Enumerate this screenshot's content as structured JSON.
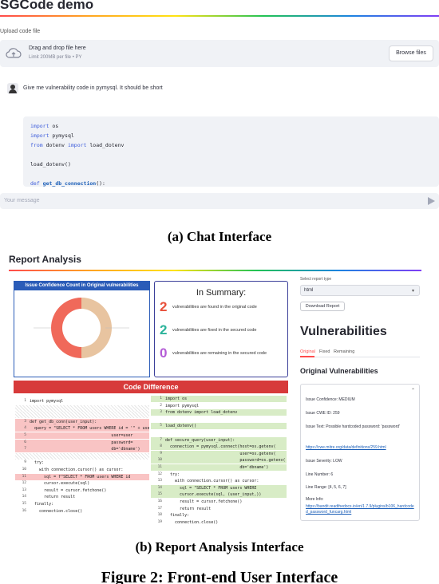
{
  "chat": {
    "app_title": "SGCode demo",
    "upload_label": "Upload code file",
    "dropzone": {
      "main_text": "Drag and drop file here",
      "limit_text": "Limit 200MB per file • PY",
      "browse_label": "Browse files",
      "icon": "cloud-upload-icon"
    },
    "user_message": "Give me vulnerability code in pymysql. It should be short",
    "code_lines": [
      [
        {
          "t": "import",
          "k": "kw"
        },
        {
          "t": " os",
          "k": ""
        }
      ],
      [
        {
          "t": "import",
          "k": "kw"
        },
        {
          "t": " pymysql",
          "k": ""
        }
      ],
      [
        {
          "t": "from",
          "k": "kw"
        },
        {
          "t": " dotenv ",
          "k": ""
        },
        {
          "t": "import",
          "k": "kw"
        },
        {
          "t": " load_dotenv",
          "k": ""
        }
      ],
      [],
      [
        {
          "t": "load_dotenv()",
          "k": ""
        }
      ],
      [],
      [
        {
          "t": "def",
          "k": "kw"
        },
        {
          "t": " get_db_connection",
          "k": "fn"
        },
        {
          "t": "():",
          "k": ""
        }
      ]
    ],
    "input_placeholder": "Your message",
    "send_icon": "send-icon"
  },
  "caption_a": "(a) Chat Interface",
  "report": {
    "title": "Report Analysis",
    "chart_card": {
      "title": "Issue Confidence Count in Original vulnerabilities"
    },
    "chart_data": {
      "type": "pie",
      "donut": true,
      "title": "Issue Confidence Count in Original vulnerabilities",
      "slices": [
        {
          "value": 1,
          "color": "#e8c4a0"
        },
        {
          "value": 1,
          "color": "#f0695a"
        }
      ]
    },
    "summary": {
      "title": "In Summary:",
      "stats": [
        {
          "value": "2",
          "text": "vulnerabilities are found in the original code",
          "color": "#e8503a"
        },
        {
          "value": "2",
          "text": "vulnerabilities are fixed in the secured code",
          "color": "#2bb39a"
        },
        {
          "value": "0",
          "text": "vulnerabilities are remaining in the secured code",
          "color": "#b45cd6"
        }
      ]
    },
    "diff": {
      "title": "Code Difference",
      "left": [
        {
          "n": "1",
          "t": "import pymysql",
          "s": ""
        },
        {
          "n": "",
          "t": "",
          "s": "hatch"
        },
        {
          "n": "",
          "t": "",
          "s": "hatch"
        },
        {
          "n": "3",
          "t": "def get_db_conn(user_input):",
          "s": "del"
        },
        {
          "n": "4",
          "t": "  query = \"SELECT * FROM users WHERE id = '\" + user_input",
          "s": "del"
        },
        {
          "n": "5",
          "t": "                                  user=user",
          "s": "del"
        },
        {
          "n": "6",
          "t": "                                  password=",
          "s": "del"
        },
        {
          "n": "7",
          "t": "                                  db='dbname')",
          "s": "del"
        },
        {
          "n": "",
          "t": "",
          "s": "hatch"
        },
        {
          "n": "9",
          "t": "  try:",
          "s": ""
        },
        {
          "n": "10",
          "t": "    with connection.cursor() as cursor:",
          "s": ""
        },
        {
          "n": "11",
          "t": "      sql = f\"SELECT * FROM users WHERE id",
          "s": "del"
        },
        {
          "n": "12",
          "t": "      cursor.execute(sql)",
          "s": ""
        },
        {
          "n": "13",
          "t": "      result = cursor.fetchone()",
          "s": ""
        },
        {
          "n": "14",
          "t": "      return result",
          "s": ""
        },
        {
          "n": "15",
          "t": "  finally:",
          "s": ""
        },
        {
          "n": "16",
          "t": "    connection.close()",
          "s": ""
        }
      ],
      "right": [
        {
          "n": "1",
          "t": "import os",
          "s": "add"
        },
        {
          "n": "2",
          "t": "import pymysql",
          "s": ""
        },
        {
          "n": "3",
          "t": "from dotenv import load_dotenv",
          "s": "add"
        },
        {
          "n": "",
          "t": "",
          "s": ""
        },
        {
          "n": "5",
          "t": "load_dotenv()",
          "s": "add"
        },
        {
          "n": "",
          "t": "",
          "s": ""
        },
        {
          "n": "7",
          "t": "def secure_query(user_input):",
          "s": "add"
        },
        {
          "n": "8",
          "t": "  connection = pymysql.connect(host=os.getenv(",
          "s": "add"
        },
        {
          "n": "9",
          "t": "                               user=os.getenv(",
          "s": "add"
        },
        {
          "n": "10",
          "t": "                               password=os.getenv(",
          "s": "add"
        },
        {
          "n": "11",
          "t": "                               db='dbname')",
          "s": "add"
        },
        {
          "n": "12",
          "t": "  try:",
          "s": ""
        },
        {
          "n": "13",
          "t": "    with connection.cursor() as cursor:",
          "s": ""
        },
        {
          "n": "14",
          "t": "      sql = \"SELECT * FROM users WHERE",
          "s": "add"
        },
        {
          "n": "15",
          "t": "      cursor.execute(sql, (user_input,))",
          "s": "add"
        },
        {
          "n": "16",
          "t": "      result = cursor.fetchone()",
          "s": ""
        },
        {
          "n": "17",
          "t": "      return result",
          "s": ""
        },
        {
          "n": "18",
          "t": "  finally:",
          "s": ""
        },
        {
          "n": "19",
          "t": "    connection.close()",
          "s": ""
        }
      ]
    },
    "select_label": "Select report type",
    "select_value": "html",
    "download_label": "Download Report",
    "vuln_title": "Vulnerabilities",
    "tabs": [
      "Original",
      "Fixed",
      "Remaining"
    ],
    "orig_title": "Original Vulnerabilities",
    "issue": {
      "confidence": "Issue Confidence: MEDIUM",
      "cwe_id": "Issue CWE ID: 259",
      "text": "Issue Text: Possible hardcoded password: 'password'",
      "cwe_link": "https://cwe.mitre.org/data/definitions/259.html",
      "severity": "Issue Severity: LOW",
      "line_number": "Line Number: 6",
      "line_range": "Line Range: [4, 5, 6, 7]",
      "more_info_label": "More Info:",
      "more_info_link": "https://bandit.readthedocs.io/en/1.7.9/plugins/b106_hardcoded_password_funcarg.html"
    }
  },
  "caption_b": "(b) Report Analysis Interface",
  "figure_caption": "Figure 2: Front-end User Interface"
}
